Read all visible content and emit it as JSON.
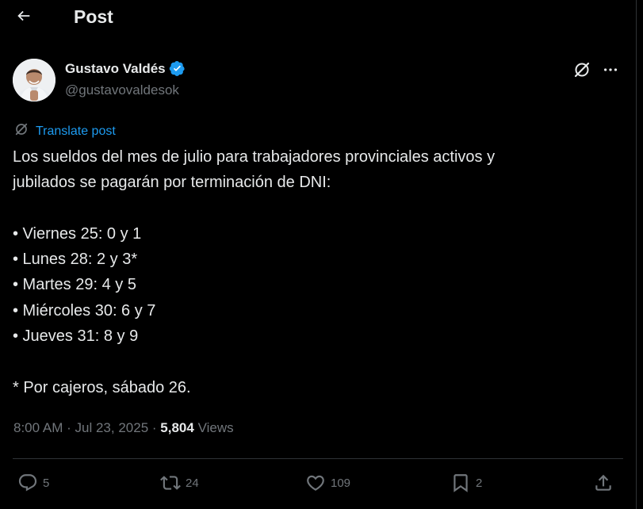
{
  "header": {
    "title": "Post"
  },
  "author": {
    "name": "Gustavo Valdés",
    "handle": "@gustavovaldesok",
    "verified": true
  },
  "translate": {
    "label": "Translate post"
  },
  "post": {
    "lines": [
      "Los sueldos del mes de julio para trabajadores provinciales activos y",
      "jubilados se pagarán por terminación de DNI:",
      "",
      "• Viernes 25: 0 y 1",
      "• Lunes 28: 2 y 3*",
      "• Martes 29: 4 y 5",
      "• Miércoles 30: 6 y 7",
      "• Jueves 31: 8 y 9",
      "",
      "* Por cajeros, sábado 26."
    ]
  },
  "meta": {
    "time": "8:00 AM",
    "date": "Jul 23, 2025",
    "separator": "·",
    "views_count": "5,804",
    "views_label": "Views"
  },
  "actions": {
    "replies": "5",
    "reposts": "24",
    "likes": "109",
    "bookmarks": "2"
  },
  "colors": {
    "background": "#000000",
    "text": "#e7e9ea",
    "secondary": "#71767b",
    "accent": "#1d9bf0",
    "divider": "#2f3336"
  },
  "icons": {
    "back": "arrow-left-icon",
    "verified": "verified-badge-icon",
    "grok": "grok-icon",
    "more": "more-horizontal-icon",
    "reply": "reply-icon",
    "repost": "repost-icon",
    "like": "heart-icon",
    "bookmark": "bookmark-icon",
    "share": "share-icon"
  }
}
